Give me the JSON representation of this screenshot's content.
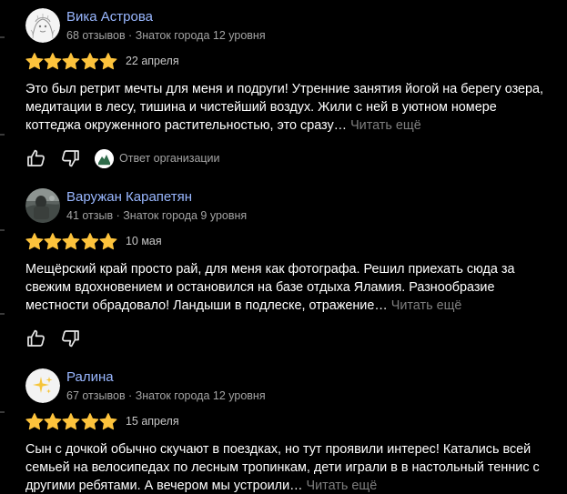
{
  "colors": {
    "background": "#000000",
    "author_name": "#99b7ff",
    "star": "#fdc33c",
    "muted": "#a4a4a4",
    "read_more": "#7e7e7e"
  },
  "reviews": [
    {
      "author": "Вика Астрова",
      "meta": "68 отзывов · Знаток города 12 уровня",
      "stars": 5,
      "date": "22 апреля",
      "text": "Это был ретрит мечты для меня и подруги! Утренние занятия йогой на берегу озера, медитации в лесу, тишина и чистейший воздух. Жили с ней в уютном номере коттеджа окруженного растительностью, это сразу…",
      "read_more": "Читать ещё",
      "avatar_icon": "sketch-avatar-icon",
      "org_reply_label": "Ответ организации"
    },
    {
      "author": "Варужан Карапетян",
      "meta": "41 отзыв · Знаток города 9 уровня",
      "stars": 5,
      "date": "10 мая",
      "text": "Мещёрский край просто рай, для меня как фотографа. Решил приехать сюда за свежим вдохновением и остановился на базе отдыха Яламия. Разнообразие местности обрадовало! Ландыши в подлеске, отражение…",
      "read_more": "Читать ещё",
      "avatar_icon": "photo-avatar-icon"
    },
    {
      "author": "Ралина",
      "meta": "67 отзывов · Знаток города 12 уровня",
      "stars": 5,
      "date": "15 апреля",
      "text": "Сын с дочкой обычно скучают в поездках, но тут проявили интерес! Катались всей семьей на велосипедах по лесным тропинкам, дети играли в в настольный теннис с другими ребятами. А вечером мы устроили…",
      "read_more": "Читать ещё",
      "avatar_icon": "sparkles-avatar-icon"
    }
  ]
}
